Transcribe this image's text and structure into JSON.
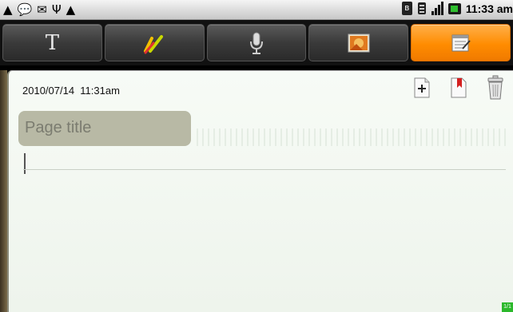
{
  "statusbar": {
    "left_icons": [
      "warning-icon",
      "chat-icon",
      "mail-icon",
      "usb-icon",
      "warning-icon"
    ],
    "right_icons": [
      "bluetooth-icon",
      "wifi-icon",
      "signal-icon",
      "battery-icon"
    ],
    "time": "11:33 am"
  },
  "toolbar": {
    "tabs": [
      {
        "name": "text",
        "icon": "text-icon",
        "glyph": "T",
        "active": false
      },
      {
        "name": "draw",
        "icon": "pen-icon",
        "active": false
      },
      {
        "name": "voice",
        "icon": "microphone-icon",
        "active": false
      },
      {
        "name": "image",
        "icon": "picture-icon",
        "active": false
      },
      {
        "name": "note",
        "icon": "note-edit-icon",
        "active": true
      }
    ],
    "active_color": "#ff8c00"
  },
  "note": {
    "timestamp": "2010/07/14  11:31am",
    "title_placeholder": "Page title",
    "body_text": "",
    "actions": [
      "add-page-icon",
      "bookmark-icon",
      "trash-icon"
    ],
    "page_indicator": "1/1"
  }
}
